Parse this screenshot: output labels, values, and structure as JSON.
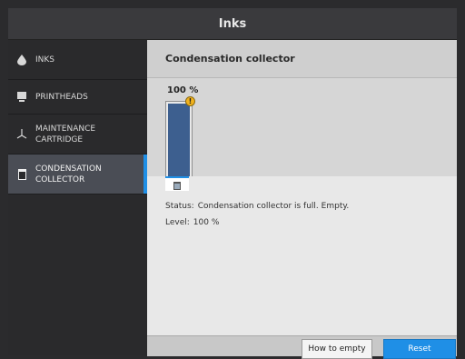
{
  "window": {
    "title": "Inks"
  },
  "sidebar": {
    "items": [
      {
        "label": "INKS",
        "icon": "ink-drop-icon"
      },
      {
        "label": "PRINTHEADS",
        "icon": "printhead-icon"
      },
      {
        "label": "MAINTENANCE\nCARTRIDGE",
        "icon": "maintenance-cartridge-icon"
      },
      {
        "label": "CONDENSATION\nCOLLECTOR",
        "icon": "condensation-collector-icon",
        "selected": true
      }
    ]
  },
  "main": {
    "title": "Condensation collector",
    "level_percent_label": "100 %",
    "level_fraction": 1.0,
    "warning_symbol": "!",
    "status": {
      "key": "Status:",
      "value": "Condensation collector is full. Empty."
    },
    "level": {
      "key": "Level:",
      "value": "100 %"
    }
  },
  "footer": {
    "how_to_empty_label": "How to empty",
    "reset_label": "Reset"
  },
  "colors": {
    "accent": "#1f8fe6",
    "gauge_fill": "#3d5f8f",
    "warning": "#f1b21d"
  }
}
